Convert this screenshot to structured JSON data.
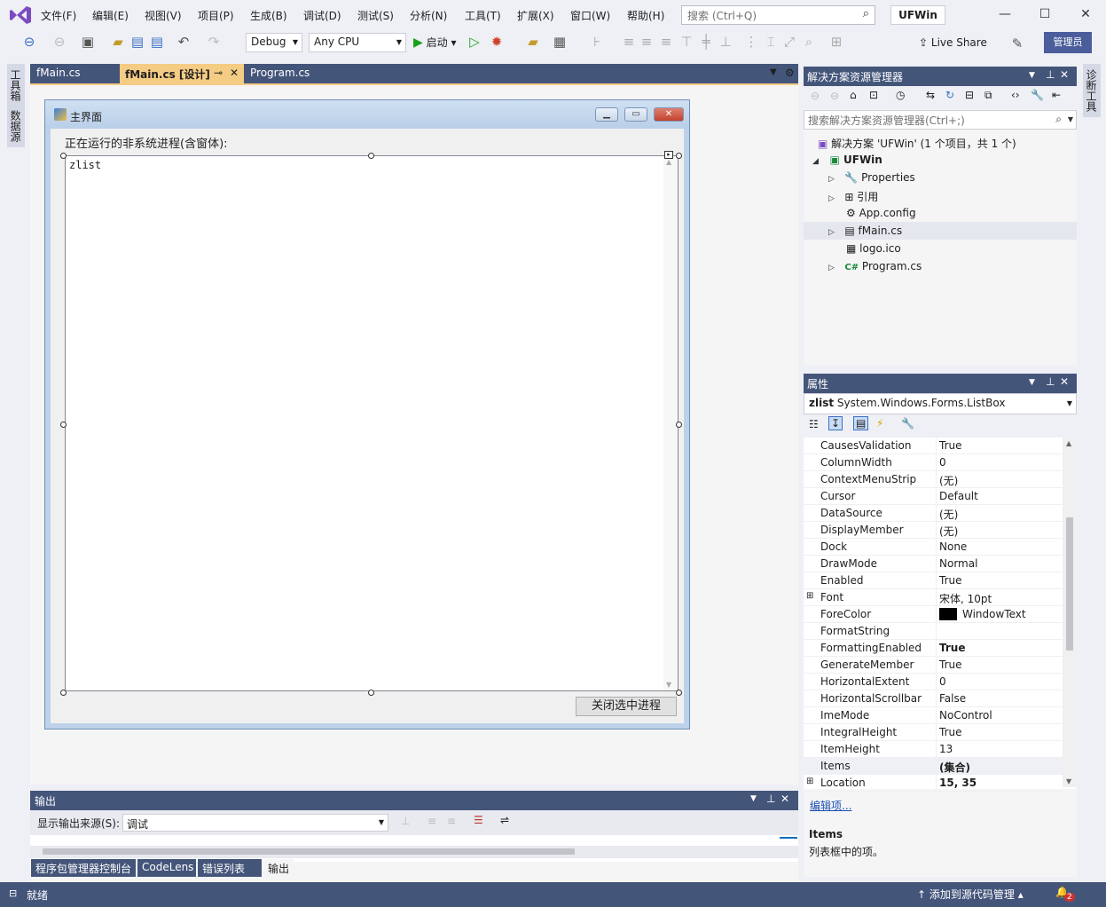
{
  "menu": [
    "文件(F)",
    "编辑(E)",
    "视图(V)",
    "项目(P)",
    "生成(B)",
    "调试(D)",
    "测试(S)",
    "分析(N)",
    "工具(T)",
    "扩展(X)",
    "窗口(W)",
    "帮助(H)"
  ],
  "search_placeholder": "搜索 (Ctrl+Q)",
  "solution_name": "UFWin",
  "toolbar": {
    "config": "Debug",
    "platform": "Any CPU",
    "start": "启动",
    "live_share": "Live Share",
    "admin": "管理员"
  },
  "left_tabs": [
    "工具箱",
    "数据源"
  ],
  "right_tabs": [
    "诊断工具"
  ],
  "doc_tabs": [
    "fMain.cs",
    "fMain.cs [设计]",
    "Program.cs"
  ],
  "form": {
    "title": "主界面",
    "label": "正在运行的非系统进程(含窗体):",
    "listbox_text": "zlist",
    "button": "关闭选中进程"
  },
  "output": {
    "title": "输出",
    "source_label": "显示输出来源(S):",
    "source_value": "调试"
  },
  "bottom_tabs": [
    "程序包管理器控制台",
    "CodeLens",
    "错误列表 ...",
    "输出"
  ],
  "solution_explorer": {
    "title": "解决方案资源管理器",
    "search_placeholder": "搜索解决方案资源管理器(Ctrl+;)",
    "items": [
      "解决方案 'UFWin' (1 个项目，共 1 个)",
      "UFWin",
      "Properties",
      "引用",
      "App.config",
      "fMain.cs",
      "logo.ico",
      "Program.cs"
    ]
  },
  "properties": {
    "title": "属性",
    "object_name": "zlist",
    "object_type": "System.Windows.Forms.ListBox",
    "rows": [
      {
        "name": "CausesValidation",
        "value": "True"
      },
      {
        "name": "ColumnWidth",
        "value": "0"
      },
      {
        "name": "ContextMenuStrip",
        "value": "(无)"
      },
      {
        "name": "Cursor",
        "value": "Default"
      },
      {
        "name": "DataSource",
        "value": "(无)"
      },
      {
        "name": "DisplayMember",
        "value": "(无)"
      },
      {
        "name": "Dock",
        "value": "None"
      },
      {
        "name": "DrawMode",
        "value": "Normal"
      },
      {
        "name": "Enabled",
        "value": "True"
      },
      {
        "name": "Font",
        "value": "宋体, 10pt"
      },
      {
        "name": "ForeColor",
        "value": "WindowText"
      },
      {
        "name": "FormatString",
        "value": ""
      },
      {
        "name": "FormattingEnabled",
        "value": "True"
      },
      {
        "name": "GenerateMember",
        "value": "True"
      },
      {
        "name": "HorizontalExtent",
        "value": "0"
      },
      {
        "name": "HorizontalScrollbar",
        "value": "False"
      },
      {
        "name": "ImeMode",
        "value": "NoControl"
      },
      {
        "name": "IntegralHeight",
        "value": "True"
      },
      {
        "name": "ItemHeight",
        "value": "13"
      },
      {
        "name": "Items",
        "value": "(集合)"
      },
      {
        "name": "Location",
        "value": "15, 35"
      }
    ],
    "edit_link": "编辑项...",
    "desc_name": "Items",
    "desc_text": "列表框中的项。"
  },
  "status": {
    "ready": "就绪",
    "source_control": "添加到源代码管理",
    "notifications": "2"
  }
}
